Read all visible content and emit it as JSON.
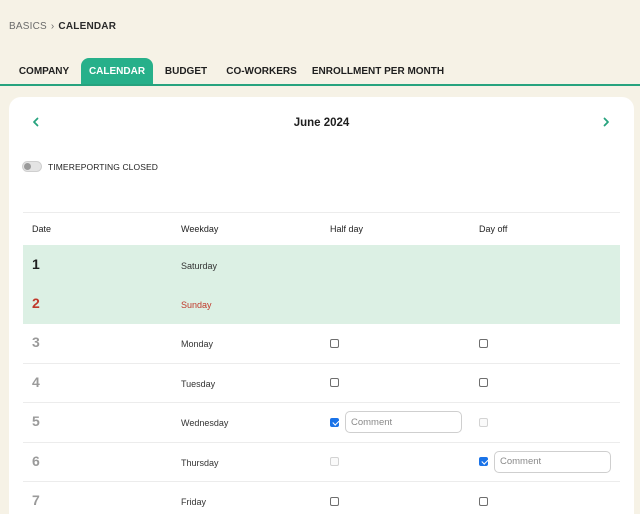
{
  "breadcrumb": {
    "root": "BASICS",
    "separator": "›",
    "current": "CALENDAR"
  },
  "tabs": [
    {
      "label": "COMPANY",
      "active": false
    },
    {
      "label": "CALENDAR",
      "active": true
    },
    {
      "label": "BUDGET",
      "active": false
    },
    {
      "label": "CO-WORKERS",
      "active": false
    },
    {
      "label": "ENROLLMENT PER MONTH",
      "active": false
    }
  ],
  "calendar": {
    "month_title": "June 2024",
    "prev_icon": "chevron-left-icon",
    "next_icon": "chevron-right-icon",
    "toggle_label": "TIMEREPORTING CLOSED",
    "toggle_on": false
  },
  "table": {
    "headers": {
      "date": "Date",
      "weekday": "Weekday",
      "half_day": "Half day",
      "day_off": "Day off"
    },
    "rows": [
      {
        "date": "1",
        "weekday": "Saturday",
        "weekend": true
      },
      {
        "date": "2",
        "weekday": "Sunday",
        "weekend": true
      },
      {
        "date": "3",
        "weekday": "Monday",
        "half_day": false,
        "day_off": false
      },
      {
        "date": "4",
        "weekday": "Tuesday",
        "half_day": false,
        "day_off": false
      },
      {
        "date": "5",
        "weekday": "Wednesday",
        "half_day": true,
        "half_day_comment_placeholder": "Comment",
        "day_off": false,
        "day_off_disabled": true
      },
      {
        "date": "6",
        "weekday": "Thursday",
        "half_day": false,
        "half_day_disabled": true,
        "day_off": true,
        "day_off_comment_placeholder": "Comment"
      },
      {
        "date": "7",
        "weekday": "Friday",
        "half_day": false,
        "day_off": false
      }
    ]
  },
  "colors": {
    "background": "#f6f2e6",
    "accent": "#27b08a",
    "weekend_row": "#dcf0e4",
    "sunday_text": "#c0392b",
    "checkbox_checked": "#1a73e8"
  }
}
